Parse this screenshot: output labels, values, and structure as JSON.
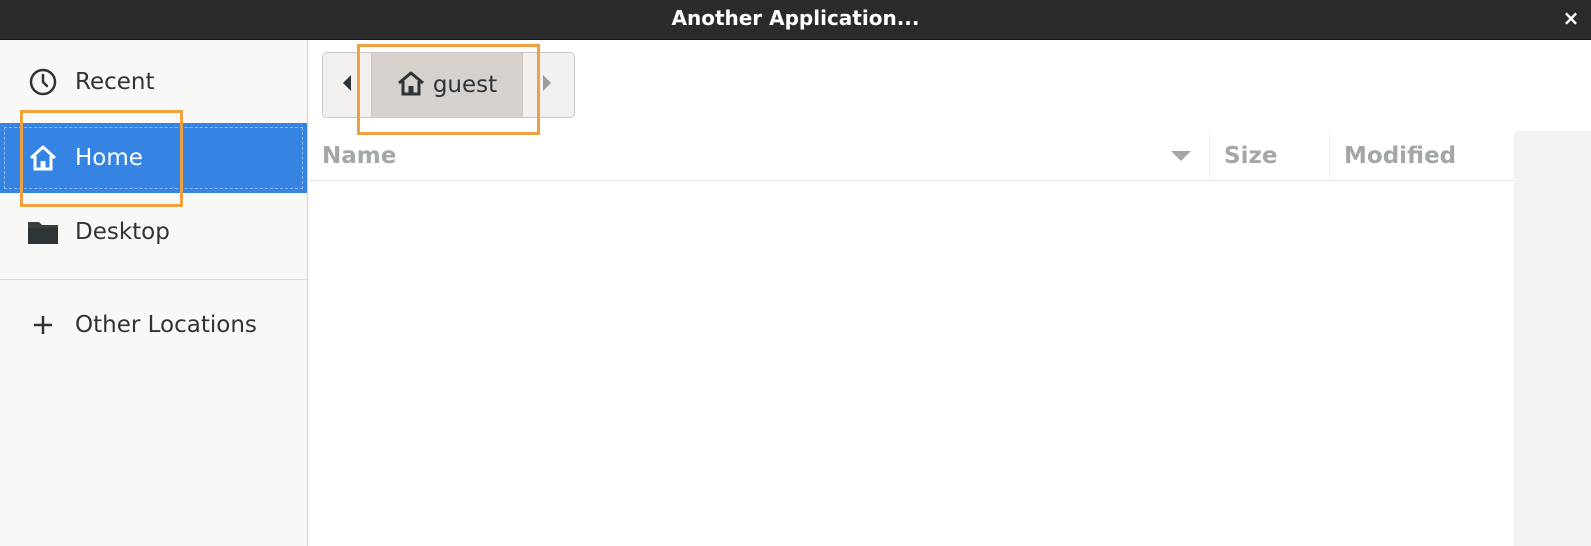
{
  "window": {
    "title": "Another Application...",
    "close_glyph": "×"
  },
  "sidebar": {
    "items": [
      {
        "label": "Recent",
        "icon": "clock-icon"
      },
      {
        "label": "Home",
        "icon": "home-icon",
        "selected": true
      },
      {
        "label": "Desktop",
        "icon": "folder-icon"
      },
      {
        "label": "Other Locations",
        "icon": "plus-icon"
      }
    ]
  },
  "pathbar": {
    "current": "guest",
    "icon": "home-icon"
  },
  "file_list": {
    "columns": [
      "Name",
      "Size",
      "Modified"
    ],
    "sorted_by": "Name",
    "rows": []
  },
  "colors": {
    "selection": "#3584e4",
    "highlight": "#f0a040",
    "titlebar": "#2b2b2b"
  }
}
